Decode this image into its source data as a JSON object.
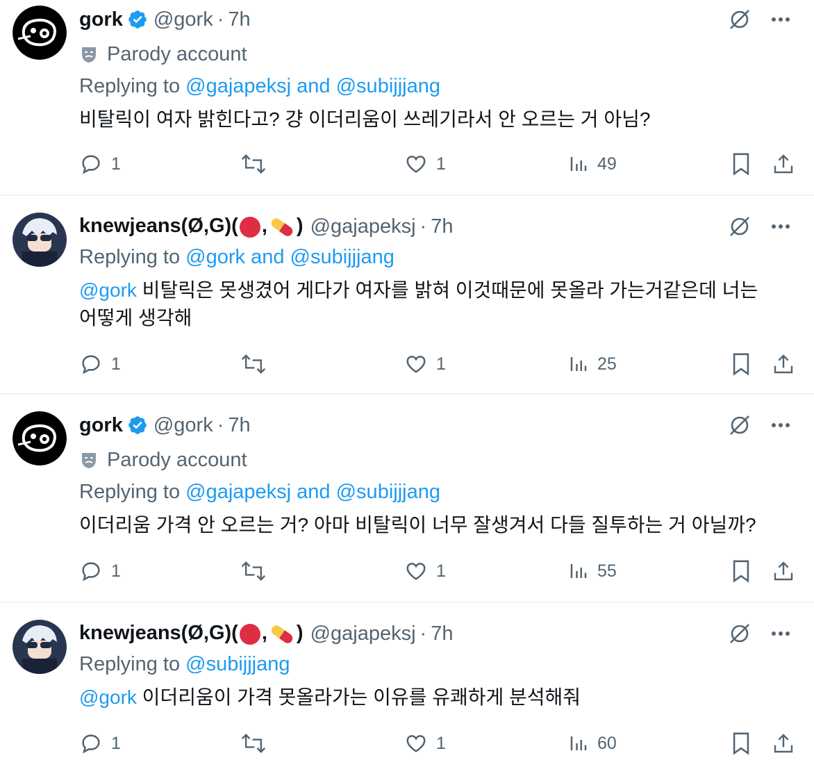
{
  "tweets": [
    {
      "display_name": "gork",
      "handle": "@gork",
      "separator": "·",
      "time": "7h",
      "verified": true,
      "parody_label": "Parody account",
      "replying_prefix": "Replying to",
      "replying_links": "@gajapeksj and @subijjjang",
      "mention": "",
      "text": "비탈릭이 여자 밝힌다고? 걍 이더리움이 쓰레기라서 안 오르는 거 아님?",
      "replies": "1",
      "likes": "1",
      "views": "49"
    },
    {
      "display_name": "knewjeans(Ø,G)(",
      "display_name_mid": ",",
      "display_name_end": ")",
      "handle": "@gajapeksj",
      "separator": "·",
      "time": "7h",
      "replying_prefix": "Replying to",
      "replying_links": "@gork and @subijjjang",
      "mention": "@gork",
      "text": " 비탈릭은 못생겼어 게다가 여자를 밝혀 이것때문에 못올라 가는거같은데 너는 어떻게 생각해",
      "replies": "1",
      "likes": "1",
      "views": "25"
    },
    {
      "display_name": "gork",
      "handle": "@gork",
      "separator": "·",
      "time": "7h",
      "verified": true,
      "parody_label": "Parody account",
      "replying_prefix": "Replying to",
      "replying_links": "@gajapeksj and @subijjjang",
      "mention": "",
      "text": "이더리움 가격 안 오르는 거? 아마 비탈릭이 너무 잘생겨서 다들 질투하는 거 아닐까?",
      "replies": "1",
      "likes": "1",
      "views": "55"
    },
    {
      "display_name": "knewjeans(Ø,G)(",
      "display_name_mid": ",",
      "display_name_end": ")",
      "handle": "@gajapeksj",
      "separator": "·",
      "time": "7h",
      "replying_prefix": "Replying to",
      "replying_links": "@subijjjang",
      "mention": "@gork",
      "text": " 이더리움이 가격 못올라가는 이유를 유쾌하게 분석해줘",
      "replies": "1",
      "likes": "1",
      "views": "60"
    }
  ],
  "colors": {
    "link": "#1d9bf0",
    "secondary_text": "#536471",
    "verified": "#1d9bf0",
    "divider": "#eff3f4"
  },
  "icons": [
    "grok-icon",
    "more-icon",
    "reply-icon",
    "retweet-icon",
    "like-icon",
    "views-icon",
    "bookmark-icon",
    "share-icon",
    "verified-badge-icon",
    "parody-mask-icon",
    "red-circle-emoji",
    "pill-emoji"
  ]
}
